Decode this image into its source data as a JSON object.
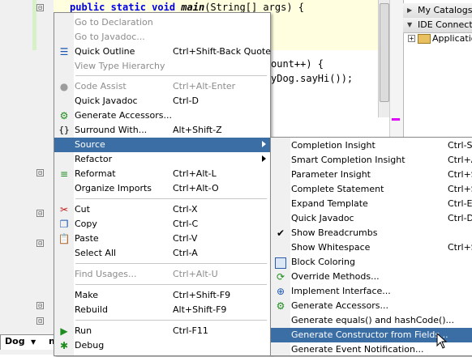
{
  "editor": {
    "code_lines": {
      "line1_keyword": "public static void ",
      "line1_method": "main",
      "line1_rest": "(String[] args) {",
      "line2": "ount++) {",
      "line3": "yDog.sayHi());"
    },
    "fold_markers": [
      "⊟",
      "⊟",
      "⊟",
      "⊟",
      "⊟",
      "⊟"
    ]
  },
  "right_panel": {
    "header1": "My Catalogs",
    "header2": "IDE Connections",
    "tree_item": "Applications"
  },
  "bottom_tab": {
    "label": "Dog",
    "arrow": "▼",
    "next": "n"
  },
  "context_menu": {
    "items": [
      {
        "label": "Go to Declaration",
        "shortcut": "",
        "disabled": true,
        "icon": "none"
      },
      {
        "label": "Go to Javadoc...",
        "shortcut": "",
        "disabled": true,
        "icon": "none"
      },
      {
        "label": "Quick Outline",
        "shortcut": "Ctrl+Shift-Back Quote",
        "disabled": false,
        "icon": "outline-icon"
      },
      {
        "label": "View Type Hierarchy",
        "shortcut": "",
        "disabled": true,
        "icon": "none"
      },
      {
        "label": "Code Assist",
        "shortcut": "Ctrl+Alt-Enter",
        "disabled": true,
        "icon": "lightbulb-icon"
      },
      {
        "label": "Quick Javadoc",
        "shortcut": "Ctrl-D",
        "disabled": false,
        "icon": "none"
      },
      {
        "label": "Generate Accessors...",
        "shortcut": "",
        "disabled": false,
        "icon": "accessors-icon"
      },
      {
        "label": "Surround With...",
        "shortcut": "Alt+Shift-Z",
        "disabled": false,
        "icon": "braces-icon"
      },
      {
        "label": "Source",
        "shortcut": "",
        "disabled": false,
        "icon": "none",
        "submenu": true,
        "selected": true
      },
      {
        "label": "Refactor",
        "shortcut": "",
        "disabled": false,
        "icon": "none",
        "submenu": true
      },
      {
        "label": "Reformat",
        "shortcut": "Ctrl+Alt-L",
        "disabled": false,
        "icon": "reformat-icon"
      },
      {
        "label": "Organize Imports",
        "shortcut": "Ctrl+Alt-O",
        "disabled": false,
        "icon": "none"
      },
      {
        "label": "Cut",
        "shortcut": "Ctrl-X",
        "disabled": false,
        "icon": "scissors-icon"
      },
      {
        "label": "Copy",
        "shortcut": "Ctrl-C",
        "disabled": false,
        "icon": "copy-icon"
      },
      {
        "label": "Paste",
        "shortcut": "Ctrl-V",
        "disabled": false,
        "icon": "paste-icon"
      },
      {
        "label": "Select All",
        "shortcut": "Ctrl-A",
        "disabled": false,
        "icon": "none"
      },
      {
        "label": "Find Usages...",
        "shortcut": "Ctrl+Alt-U",
        "disabled": true,
        "icon": "none"
      },
      {
        "label": "Make",
        "shortcut": "Ctrl+Shift-F9",
        "disabled": false,
        "icon": "none"
      },
      {
        "label": "Rebuild",
        "shortcut": "Alt+Shift-F9",
        "disabled": false,
        "icon": "none"
      },
      {
        "label": "Run",
        "shortcut": "Ctrl-F11",
        "disabled": false,
        "icon": "run-icon"
      },
      {
        "label": "Debug",
        "shortcut": "",
        "disabled": false,
        "icon": "debug-icon"
      }
    ]
  },
  "source_submenu": {
    "items": [
      {
        "label": "Completion Insight",
        "shortcut": "Ctrl-Sp",
        "icon": "none"
      },
      {
        "label": "Smart Completion Insight",
        "shortcut": "Ctrl+A",
        "icon": "none"
      },
      {
        "label": "Parameter Insight",
        "shortcut": "Ctrl+S",
        "icon": "none"
      },
      {
        "label": "Complete Statement",
        "shortcut": "Ctrl+S",
        "icon": "none"
      },
      {
        "label": "Expand Template",
        "shortcut": "Ctrl-En",
        "icon": "none"
      },
      {
        "label": "Quick Javadoc",
        "shortcut": "Ctrl-D",
        "icon": "none"
      },
      {
        "label": "Show Breadcrumbs",
        "shortcut": "",
        "icon": "check-icon",
        "checked": true
      },
      {
        "label": "Show Whitespace",
        "shortcut": "Ctrl+S",
        "icon": "none"
      },
      {
        "label": "Block Coloring",
        "shortcut": "",
        "icon": "block-coloring-icon"
      },
      {
        "label": "Override Methods...",
        "shortcut": "",
        "icon": "override-icon"
      },
      {
        "label": "Implement Interface...",
        "shortcut": "",
        "icon": "implement-icon"
      },
      {
        "label": "Generate Accessors...",
        "shortcut": "",
        "icon": "accessors-icon"
      },
      {
        "label": "Generate equals() and hashCode()...",
        "shortcut": "",
        "icon": "none"
      },
      {
        "label": "Generate Constructor from Fields...",
        "shortcut": "",
        "icon": "none",
        "selected": true
      },
      {
        "label": "Generate Event Notification...",
        "shortcut": "",
        "icon": "none"
      }
    ]
  },
  "colors": {
    "selection": "#3a6ea5",
    "keyword": "#0000e6",
    "error_stripe_mark": "#e200ff"
  }
}
